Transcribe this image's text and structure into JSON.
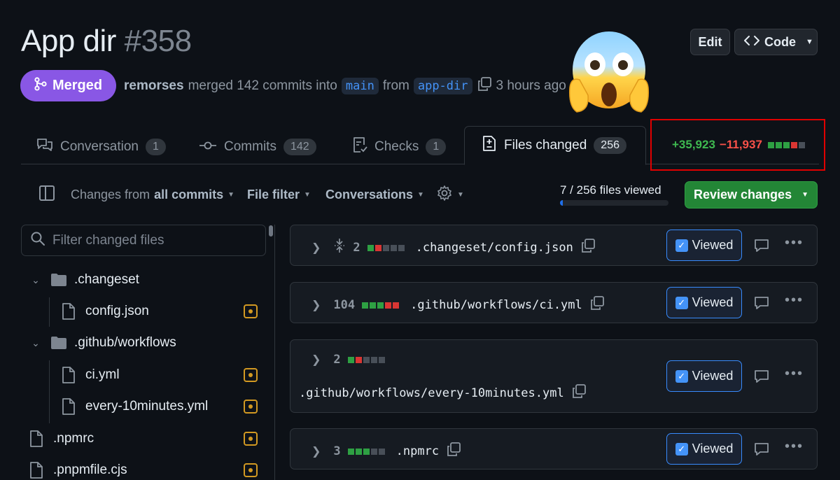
{
  "pr": {
    "title": "App dir",
    "number": "#358"
  },
  "header_actions": {
    "edit_label": "Edit",
    "code_label": "Code"
  },
  "status": {
    "badge": "Merged",
    "author": "remorses",
    "action_text": "merged 142 commits into",
    "base_branch": "main",
    "from_text": "from",
    "head_branch": "app-dir",
    "time": "3 hours ago"
  },
  "tabs": [
    {
      "label": "Conversation",
      "count": "1",
      "icon": "comment-discussion-icon"
    },
    {
      "label": "Commits",
      "count": "142",
      "icon": "git-commit-icon"
    },
    {
      "label": "Checks",
      "count": "1",
      "icon": "checklist-icon"
    },
    {
      "label": "Files changed",
      "count": "256",
      "icon": "file-diff-icon",
      "active": true
    }
  ],
  "diffstat": {
    "additions": "+35,923",
    "deletions": "−11,937",
    "blocks": [
      "g",
      "g",
      "g",
      "r",
      "n"
    ]
  },
  "toolbar": {
    "changes_prefix": "Changes from",
    "changes_value": "all commits",
    "file_filter": "File filter",
    "conversations": "Conversations",
    "files_viewed": "7 / 256 files viewed",
    "progress_fraction": 0.027,
    "review_label": "Review changes"
  },
  "filter": {
    "placeholder": "Filter changed files"
  },
  "tree": [
    {
      "type": "dir",
      "name": ".changeset",
      "depth": 0
    },
    {
      "type": "file",
      "name": "config.json",
      "depth": 1,
      "modified": true
    },
    {
      "type": "dir",
      "name": ".github/workflows",
      "depth": 0
    },
    {
      "type": "file",
      "name": "ci.yml",
      "depth": 1,
      "modified": true
    },
    {
      "type": "file",
      "name": "every-10minutes.yml",
      "depth": 1,
      "modified": true
    },
    {
      "type": "file",
      "name": ".npmrc",
      "depth": -1,
      "modified": true
    },
    {
      "type": "file",
      "name": ".pnpmfile.cjs",
      "depth": -1,
      "modified": true
    }
  ],
  "files": [
    {
      "count": "2",
      "name": ".changeset/config.json",
      "blocks": [
        "g",
        "r",
        "n",
        "n",
        "n"
      ],
      "viewed_label": "Viewed",
      "expand_icon": true
    },
    {
      "count": "104",
      "name": ".github/workflows/ci.yml",
      "blocks": [
        "g",
        "g",
        "g",
        "r",
        "r"
      ],
      "viewed_label": "Viewed"
    },
    {
      "count": "2",
      "name": ".github/workflows/every-10minutes.yml",
      "blocks": [
        "g",
        "r",
        "n",
        "n",
        "n"
      ],
      "viewed_label": "Viewed",
      "wrapped": true
    },
    {
      "count": "3",
      "name": ".npmrc",
      "blocks": [
        "g",
        "g",
        "g",
        "n",
        "n"
      ],
      "viewed_label": "Viewed"
    }
  ],
  "colors": {
    "merged": "#8957e5",
    "addition": "#3fb950",
    "deletion": "#f85149",
    "primary_button": "#238636",
    "highlight_box": "#e00000"
  }
}
